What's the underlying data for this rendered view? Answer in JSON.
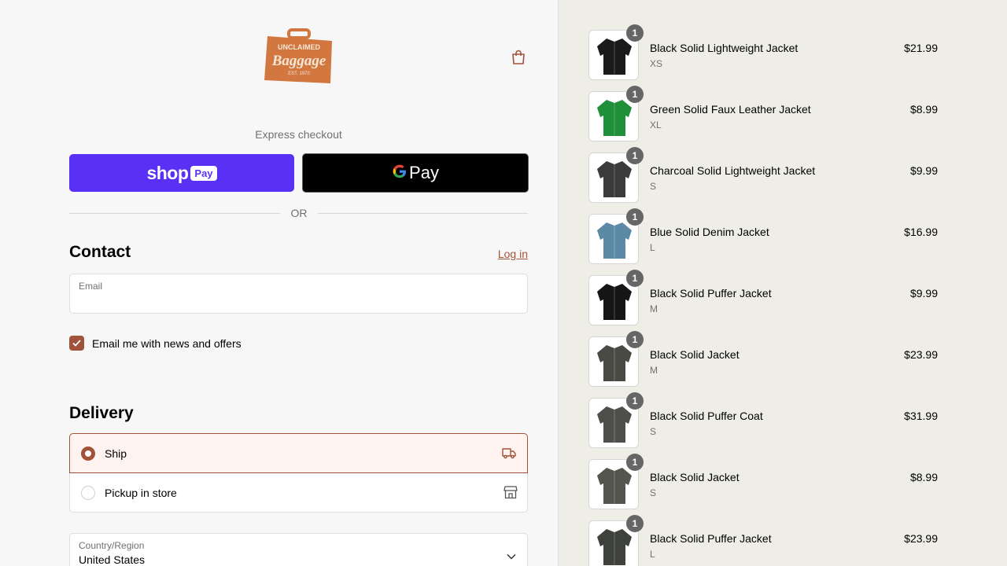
{
  "brand": {
    "logo_line1": "UNCLAIMED",
    "logo_line2": "Baggage",
    "logo_line3": "EST. 1970",
    "color": "#d2773f"
  },
  "express": {
    "label": "Express checkout",
    "shop_pay_word": "shop",
    "shop_pay_box": "Pay",
    "gpay_word": "Pay"
  },
  "divider_text": "OR",
  "contact": {
    "title": "Contact",
    "login": "Log in",
    "email_label": "Email",
    "email_value": "",
    "newsletter_label": "Email me with news and offers",
    "newsletter_checked": true
  },
  "delivery": {
    "title": "Delivery",
    "options": [
      {
        "label": "Ship",
        "selected": true,
        "icon": "truck-icon"
      },
      {
        "label": "Pickup in store",
        "selected": false,
        "icon": "store-icon"
      }
    ],
    "country_label": "Country/Region",
    "country_value": "United States"
  },
  "colors": {
    "accent": "#a0533a",
    "shop_pay": "#5a31f4",
    "summary_bg": "#eeede6"
  },
  "cart": {
    "items": [
      {
        "name": "Black Solid Lightweight Jacket",
        "variant": "XS",
        "price": "$21.99",
        "qty": "1",
        "color": "#1a1a1a"
      },
      {
        "name": "Green Solid Faux Leather Jacket",
        "variant": "XL",
        "price": "$8.99",
        "qty": "1",
        "color": "#1f8f3a"
      },
      {
        "name": "Charcoal Solid Lightweight Jacket",
        "variant": "S",
        "price": "$9.99",
        "qty": "1",
        "color": "#3b3b3b"
      },
      {
        "name": "Blue Solid Denim Jacket",
        "variant": "L",
        "price": "$16.99",
        "qty": "1",
        "color": "#5b8aa6"
      },
      {
        "name": "Black Solid Puffer Jacket",
        "variant": "M",
        "price": "$9.99",
        "qty": "1",
        "color": "#151515"
      },
      {
        "name": "Black Solid Jacket",
        "variant": "M",
        "price": "$23.99",
        "qty": "1",
        "color": "#4a4a44"
      },
      {
        "name": "Black Solid Puffer Coat",
        "variant": "S",
        "price": "$31.99",
        "qty": "1",
        "color": "#4e4f4a"
      },
      {
        "name": "Black Solid Jacket",
        "variant": "S",
        "price": "$8.99",
        "qty": "1",
        "color": "#55554f"
      },
      {
        "name": "Black Solid Puffer Jacket",
        "variant": "L",
        "price": "$23.99",
        "qty": "1",
        "color": "#3f413c"
      }
    ]
  }
}
